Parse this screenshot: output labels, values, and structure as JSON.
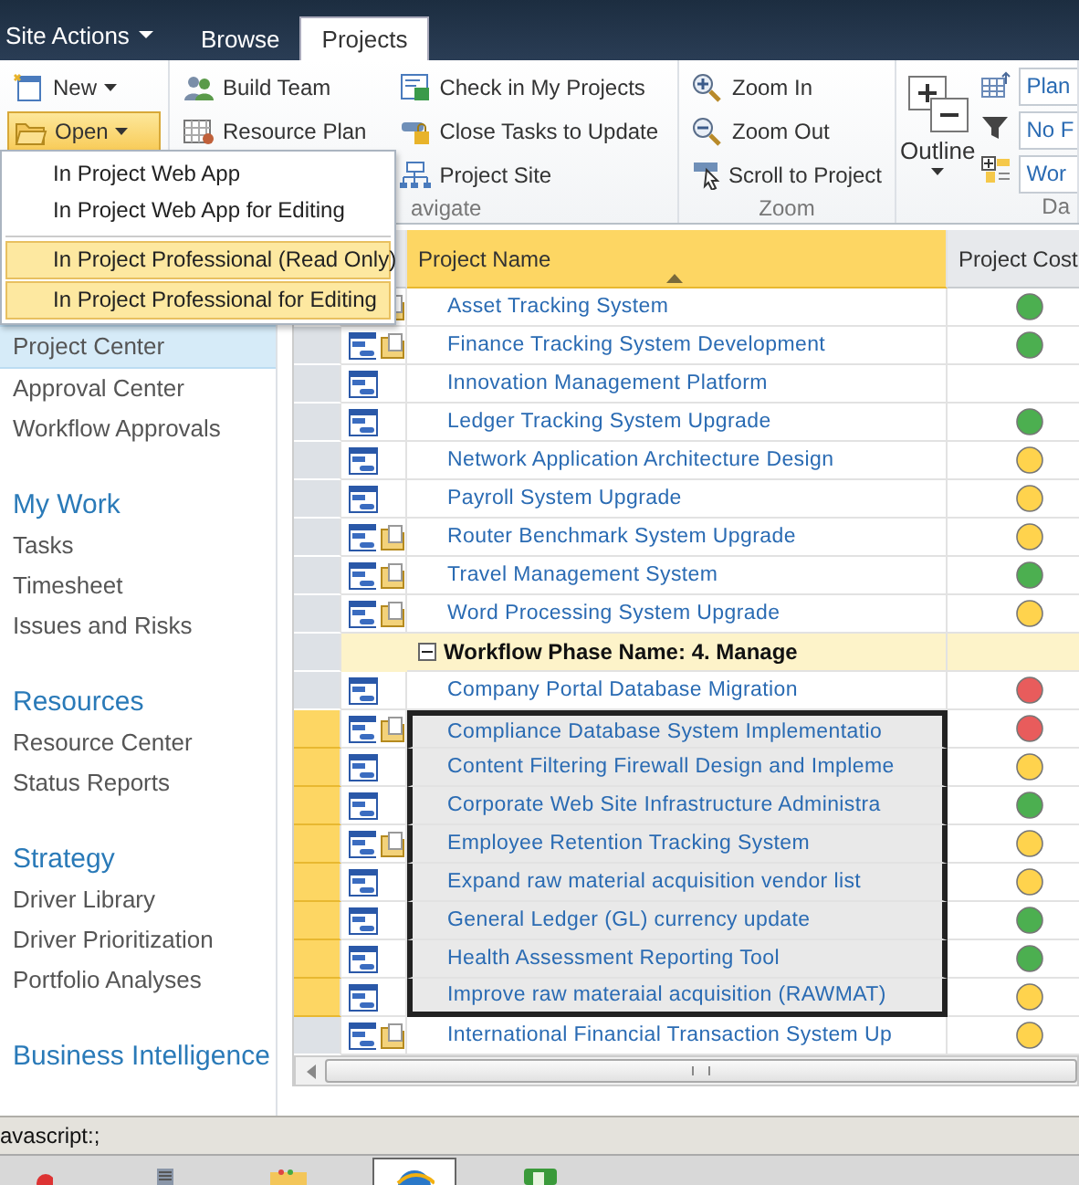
{
  "top_bar": {
    "site_actions": "Site Actions",
    "tabs": [
      {
        "label": "Browse",
        "selected": false
      },
      {
        "label": "Projects",
        "selected": true
      }
    ]
  },
  "ribbon": {
    "new_button": {
      "label": "New"
    },
    "open_button": {
      "label": "Open",
      "expanded": true
    },
    "navigate_group": {
      "label": "avigate",
      "columns": [
        [
          "Build Team",
          "Resource Plan"
        ],
        [
          "Check in My Projects",
          "Close Tasks to Update",
          "Project Site"
        ]
      ]
    },
    "zoom_group": {
      "label": "Zoom",
      "items": [
        "Zoom In",
        "Zoom Out",
        "Scroll to Project"
      ]
    },
    "data_group": {
      "label": "Da",
      "outline_label": "Outline",
      "fields": [
        "Plan",
        "No F",
        "Wor"
      ]
    }
  },
  "open_menu": {
    "items": [
      {
        "label": "In Project Web App",
        "highlighted": false
      },
      {
        "label": "In Project Web App for Editing",
        "highlighted": false
      },
      {
        "label": "In Project Professional (Read Only)",
        "highlighted": true
      },
      {
        "label": "In Project Professional for Editing",
        "highlighted": true
      }
    ]
  },
  "nav": {
    "sections": [
      {
        "items": [
          {
            "label": "Project Center",
            "selected": true
          },
          {
            "label": "Approval Center",
            "selected": false
          },
          {
            "label": "Workflow Approvals",
            "selected": false
          }
        ]
      },
      {
        "heading": "My Work",
        "items": [
          {
            "label": "Tasks",
            "selected": false
          },
          {
            "label": "Timesheet",
            "selected": false
          },
          {
            "label": "Issues and Risks",
            "selected": false
          }
        ]
      },
      {
        "heading": "Resources",
        "items": [
          {
            "label": "Resource Center",
            "selected": false
          },
          {
            "label": "Status Reports",
            "selected": false
          }
        ]
      },
      {
        "heading": "Strategy",
        "items": [
          {
            "label": "Driver Library",
            "selected": false
          },
          {
            "label": "Driver Prioritization",
            "selected": false
          },
          {
            "label": "Portfolio Analyses",
            "selected": false
          }
        ]
      },
      {
        "heading": "Business Intelligence"
      }
    ]
  },
  "grid": {
    "columns": [
      {
        "label": "Project Name",
        "sorted": true
      },
      {
        "label": "Project Cost",
        "sorted": false
      }
    ],
    "rows": [
      {
        "kind": "project",
        "name": "Asset Tracking System",
        "folder": true,
        "color": "#4caf50",
        "selected": false
      },
      {
        "kind": "project",
        "name": "Finance Tracking System Development",
        "folder": true,
        "color": "#4caf50",
        "selected": false
      },
      {
        "kind": "project",
        "name": "Innovation Management Platform",
        "folder": false,
        "selected": false
      },
      {
        "kind": "project",
        "name": "Ledger Tracking System Upgrade",
        "folder": false,
        "color": "#4caf50",
        "selected": false
      },
      {
        "kind": "project",
        "name": "Network Application Architecture Design",
        "folder": false,
        "color": "#ffd34d",
        "selected": false
      },
      {
        "kind": "project",
        "name": "Payroll System Upgrade",
        "folder": false,
        "color": "#ffd34d",
        "selected": false
      },
      {
        "kind": "project",
        "name": "Router Benchmark System Upgrade",
        "folder": true,
        "color": "#ffd34d",
        "selected": false
      },
      {
        "kind": "project",
        "name": "Travel Management System",
        "folder": true,
        "color": "#4caf50",
        "selected": false
      },
      {
        "kind": "project",
        "name": "Word Processing System Upgrade",
        "folder": true,
        "color": "#ffd34d",
        "selected": false
      },
      {
        "kind": "group",
        "name": "Workflow Phase Name: 4. Manage",
        "expanded": true
      },
      {
        "kind": "project",
        "name": "Company Portal Database Migration",
        "folder": false,
        "color": "#e85c5c",
        "selected": false
      },
      {
        "kind": "project",
        "name": "Compliance Database System Implementatio",
        "folder": true,
        "color": "#e85c5c",
        "selected": true
      },
      {
        "kind": "project",
        "name": "Content Filtering Firewall Design and Impleme",
        "folder": false,
        "color": "#ffd34d",
        "selected": true
      },
      {
        "kind": "project",
        "name": "Corporate Web Site Infrastructure Administra",
        "folder": false,
        "color": "#4caf50",
        "selected": true
      },
      {
        "kind": "project",
        "name": "Employee Retention Tracking System",
        "folder": true,
        "color": "#ffd34d",
        "selected": true
      },
      {
        "kind": "project",
        "name": "Expand raw material acquisition vendor list",
        "folder": false,
        "color": "#ffd34d",
        "selected": true
      },
      {
        "kind": "project",
        "name": "General Ledger (GL) currency update",
        "folder": false,
        "color": "#4caf50",
        "selected": true
      },
      {
        "kind": "project",
        "name": "Health Assessment Reporting Tool",
        "folder": false,
        "color": "#4caf50",
        "selected": true
      },
      {
        "kind": "project",
        "name": "Improve raw materaial acquisition (RAWMAT)",
        "folder": false,
        "color": "#ffd34d",
        "selected": true
      },
      {
        "kind": "project",
        "name": "International Financial Transaction System Up",
        "folder": true,
        "color": "#ffd34d",
        "selected": false
      }
    ]
  },
  "status_bar": {
    "text": "avascript:;"
  },
  "taskbar": [
    {
      "kind": "start",
      "selected": false
    },
    {
      "kind": "server",
      "selected": false
    },
    {
      "kind": "folder",
      "selected": false
    },
    {
      "kind": "browser",
      "selected": true
    },
    {
      "kind": "project",
      "selected": false
    }
  ]
}
